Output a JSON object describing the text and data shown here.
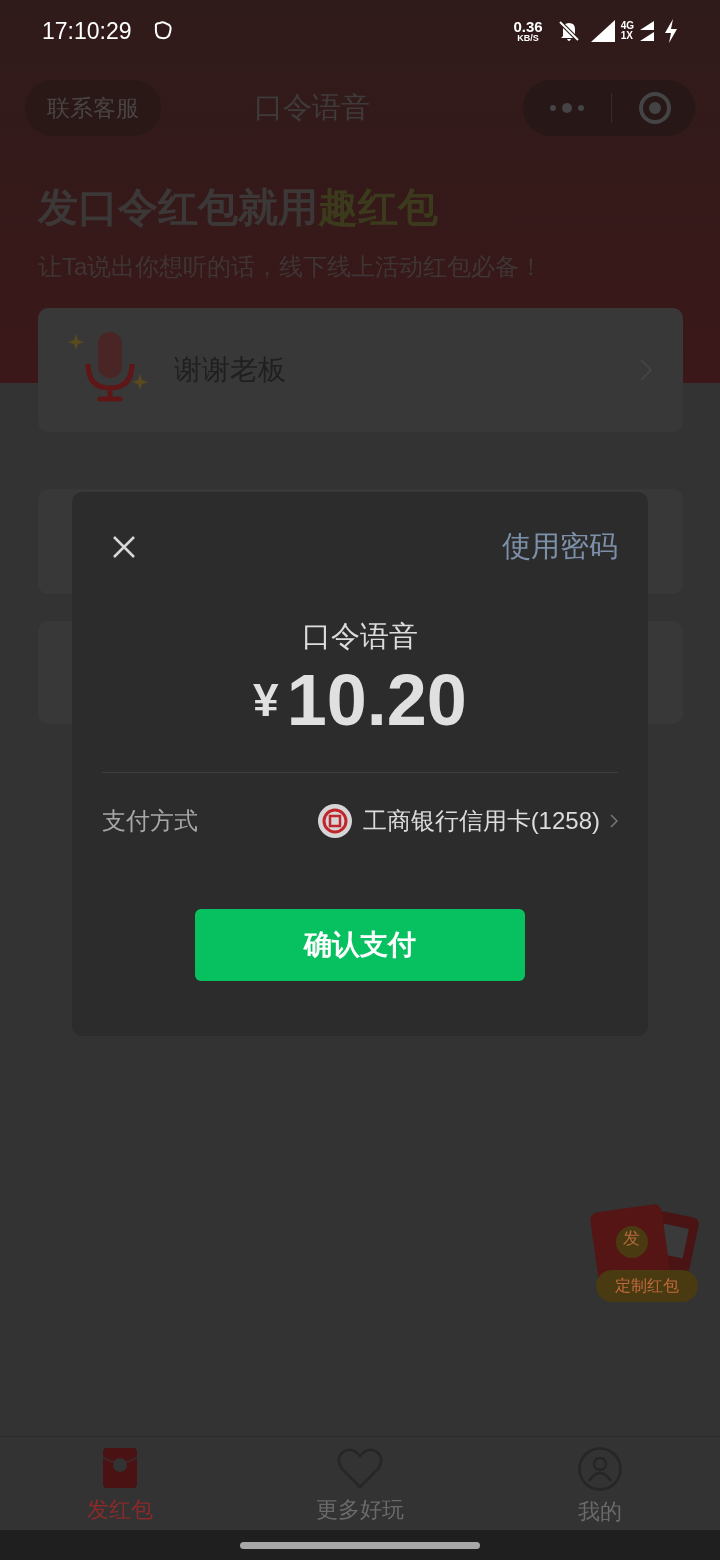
{
  "status_bar": {
    "time": "17:10:29",
    "net_speed": "0.36",
    "net_unit": "KB/S",
    "network_top": "4G",
    "network_bottom": "1X"
  },
  "header": {
    "contact_button": "联系客服",
    "title": "口令语音"
  },
  "banner": {
    "headline": "发口令红包就用",
    "headline_highlight": "趣红包",
    "subtitle": "让Ta说出你想听的话，线下线上活动红包必备！"
  },
  "command_card": {
    "text": "谢谢老板"
  },
  "payment_sheet": {
    "password_link": "使用密码",
    "title": "口令语音",
    "currency": "¥",
    "amount": "10.20",
    "method_label": "支付方式",
    "method": "工商银行信用卡(1258)",
    "confirm_button": "确认支付"
  },
  "float_badge": {
    "glyph": "发",
    "label": "定制红包"
  },
  "tabs": [
    {
      "kind": "envelope",
      "label": "发红包",
      "selected": true
    },
    {
      "kind": "heart",
      "label": "更多好玩",
      "selected": false
    },
    {
      "kind": "person",
      "label": "我的",
      "selected": false
    }
  ]
}
